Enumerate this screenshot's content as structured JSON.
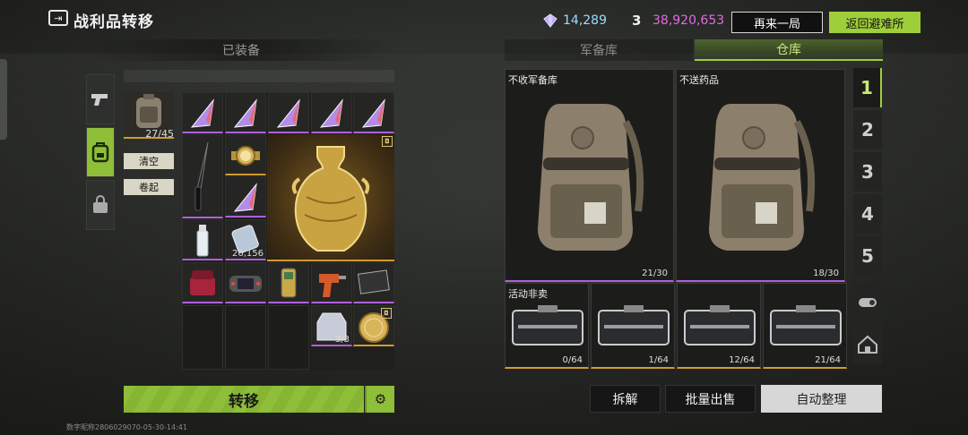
{
  "header": {
    "title": "战利品转移",
    "gems": "14,289",
    "coins": "38,920,653",
    "coin_icon": "3",
    "btn_again": "再来一局",
    "btn_back": "返回避难所"
  },
  "left": {
    "section_title": "已装备",
    "backpack_count": "27/45",
    "btn_clear": "清空",
    "btn_roll": "卷起",
    "items": {
      "tape_count": "26,156",
      "plate_count": "3/3",
      "badge": "◘"
    },
    "btn_transfer": "转移"
  },
  "right": {
    "tab_armory": "军备库",
    "tab_storage": "仓库",
    "big_boxes": [
      {
        "label": "不收军备库",
        "count": "21/30"
      },
      {
        "label": "不送药品",
        "count": "18/30"
      }
    ],
    "small_boxes": [
      {
        "label": "活动非卖",
        "count": "0/64"
      },
      {
        "label": "",
        "count": "1/64"
      },
      {
        "label": "",
        "count": "12/64"
      },
      {
        "label": "",
        "count": "21/64"
      }
    ],
    "pages": [
      "1",
      "2",
      "3",
      "4",
      "5"
    ],
    "btn_dismantle": "拆解",
    "btn_bulk_sell": "批量出售",
    "btn_auto_sort": "自动整理"
  },
  "footer": "数字昵称2806029070-05-30-14:41",
  "colors": {
    "accent": "#9ece3a",
    "purple_rarity": "#b05fdc",
    "gold_rarity": "#d49a30",
    "gem": "#9fd9ff",
    "coin": "#e06be0"
  }
}
